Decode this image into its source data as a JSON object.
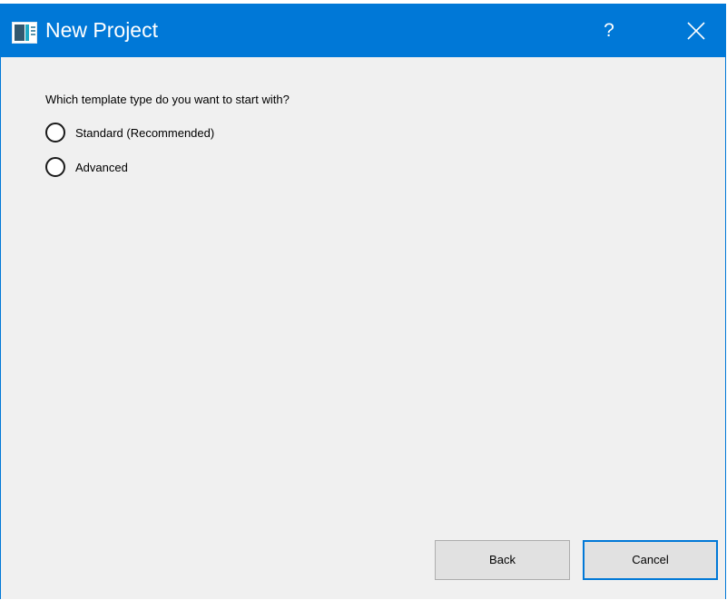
{
  "window": {
    "title": "New Project",
    "help_label": "?",
    "accent_color": "#0078d7",
    "icons": {
      "app": "project-window-icon",
      "close": "close-icon"
    }
  },
  "wizard": {
    "prompt": "Which template type do you want to start with?",
    "options": [
      {
        "label": "Standard (Recommended)",
        "selected": false
      },
      {
        "label": "Advanced",
        "selected": false
      }
    ]
  },
  "buttons": {
    "back_label": "Back",
    "cancel_label": "Cancel"
  }
}
